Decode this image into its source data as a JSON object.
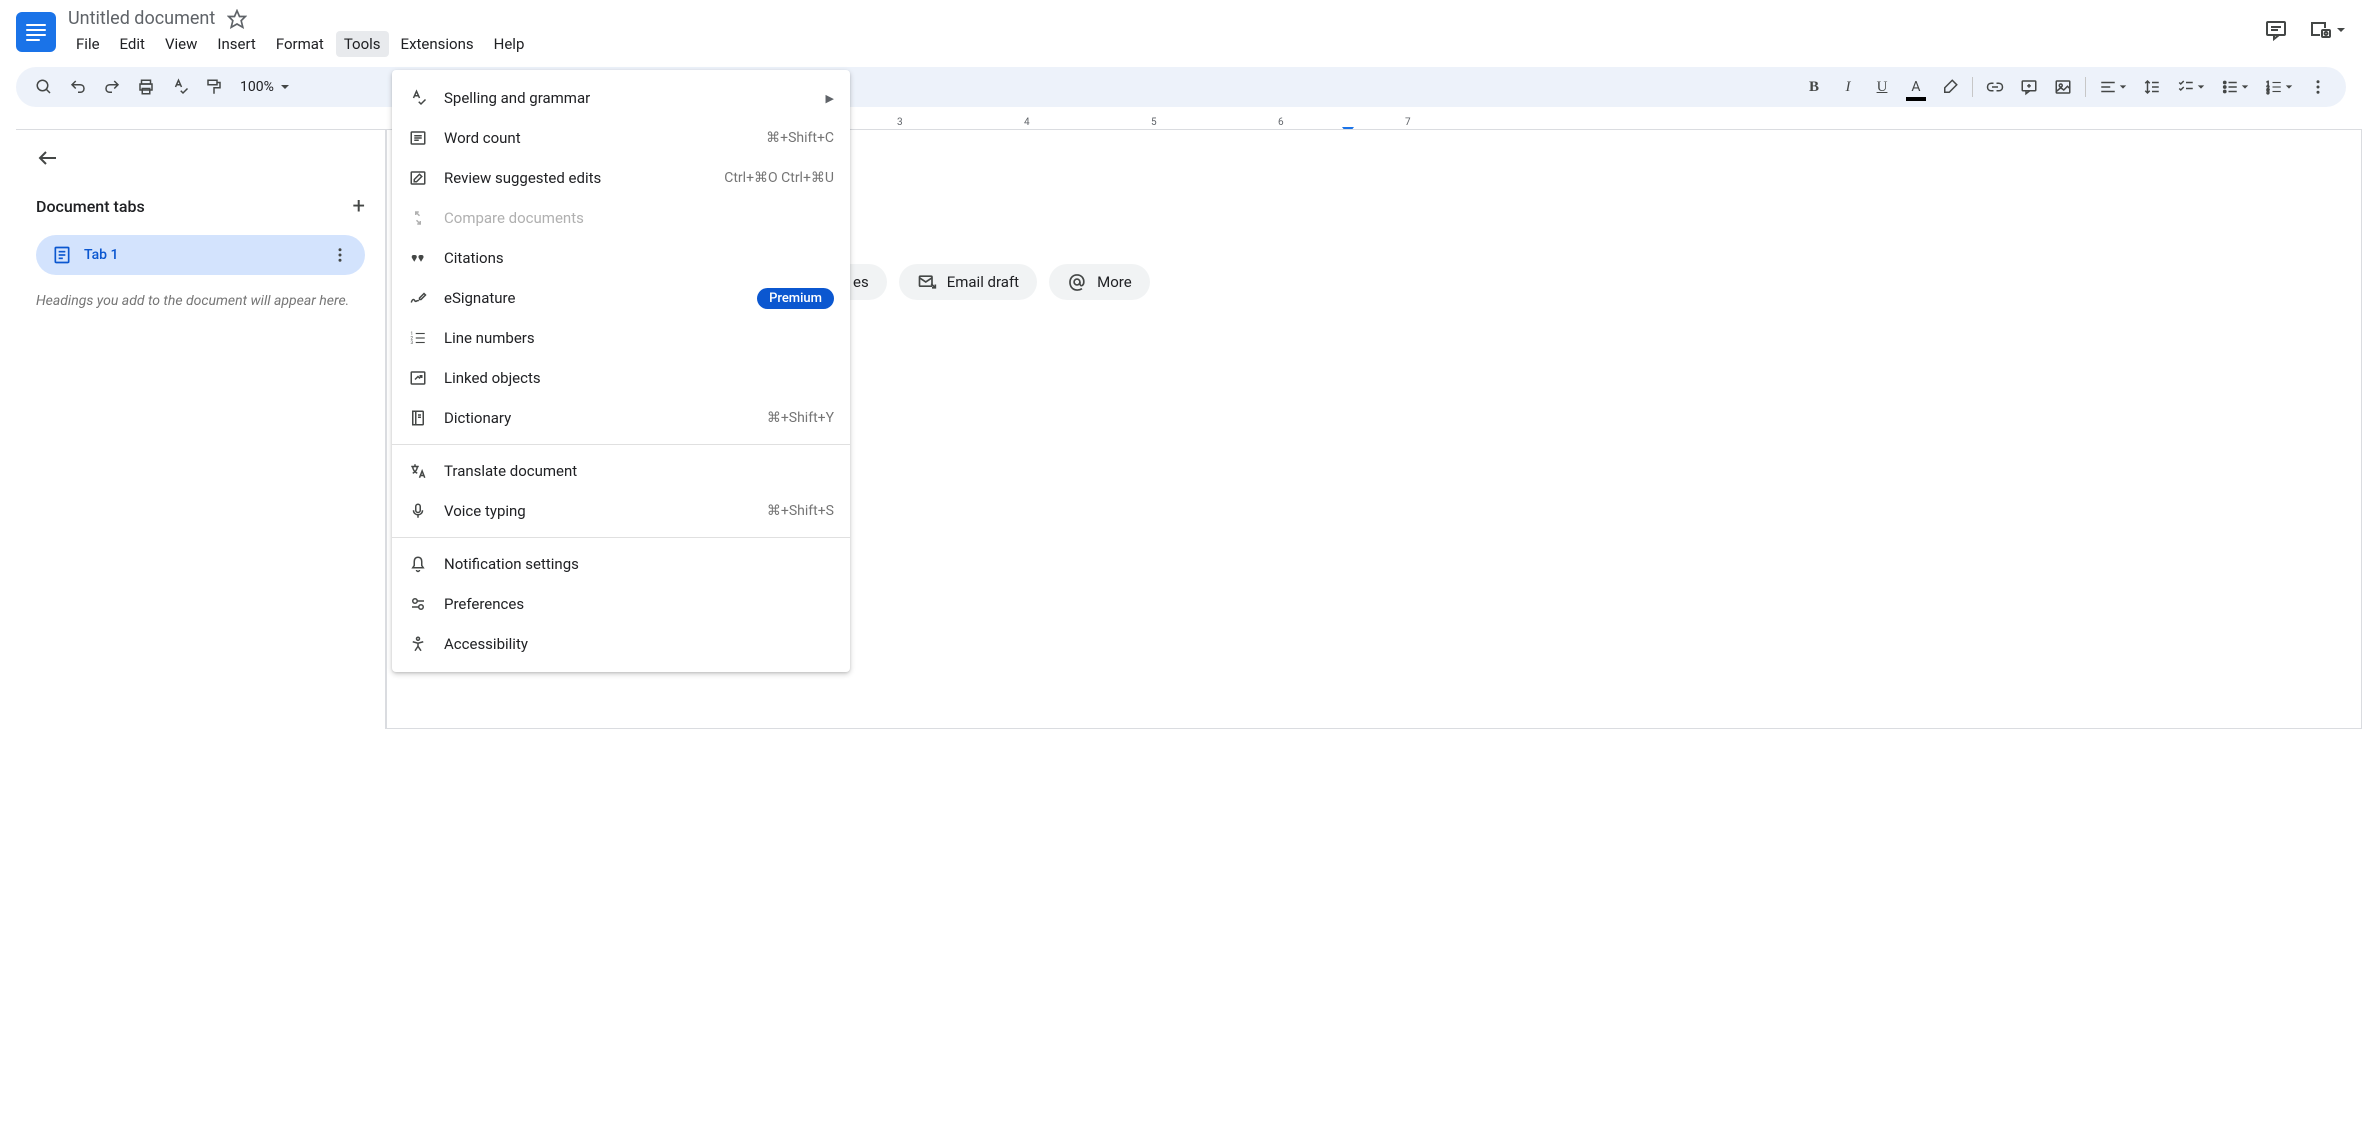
{
  "header": {
    "title": "Untitled document",
    "menus": [
      "File",
      "Edit",
      "View",
      "Insert",
      "Format",
      "Tools",
      "Extensions",
      "Help"
    ],
    "active_menu_index": 5
  },
  "toolbar": {
    "zoom": "100%"
  },
  "sidebar": {
    "title": "Document tabs",
    "tab_label": "Tab 1",
    "hint": "Headings you add to the document will appear here."
  },
  "dropdown": {
    "items": [
      {
        "icon": "spellcheck",
        "label": "Spelling and grammar",
        "submenu": true
      },
      {
        "icon": "wordcount",
        "label": "Word count",
        "shortcut": "⌘+Shift+C"
      },
      {
        "icon": "review",
        "label": "Review suggested edits",
        "shortcut": "Ctrl+⌘O Ctrl+⌘U"
      },
      {
        "icon": "compare",
        "label": "Compare documents",
        "disabled": true
      },
      {
        "icon": "citations",
        "label": "Citations"
      },
      {
        "icon": "esign",
        "label": "eSignature",
        "badge": "Premium"
      },
      {
        "icon": "linenumbers",
        "label": "Line numbers"
      },
      {
        "icon": "linked",
        "label": "Linked objects"
      },
      {
        "icon": "dictionary",
        "label": "Dictionary",
        "shortcut": "⌘+Shift+Y"
      },
      {
        "separator": true
      },
      {
        "icon": "translate",
        "label": "Translate document"
      },
      {
        "icon": "voice",
        "label": "Voice typing",
        "shortcut": "⌘+Shift+S"
      },
      {
        "separator": true
      },
      {
        "icon": "notification",
        "label": "Notification settings"
      },
      {
        "icon": "preferences",
        "label": "Preferences"
      },
      {
        "icon": "accessibility",
        "label": "Accessibility"
      }
    ]
  },
  "chips": {
    "partial_label": "es",
    "email_label": "Email draft",
    "more_label": "More"
  },
  "ruler": {
    "numbers": [
      3,
      4,
      5,
      6,
      7
    ]
  }
}
